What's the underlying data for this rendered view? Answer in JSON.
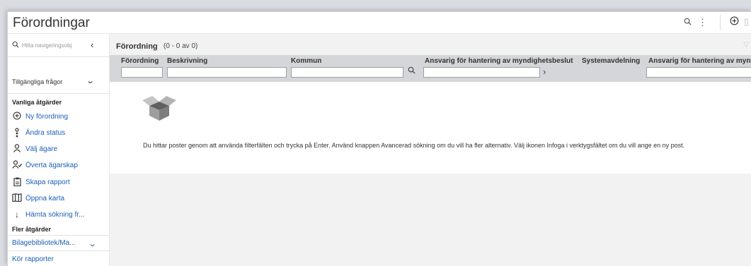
{
  "header": {
    "title": "Förordningar",
    "search_icon": "search-icon",
    "more_icon": "more-vertical-icon",
    "add_icon": "add-circle-icon"
  },
  "sidebar": {
    "search_placeholder": "Hitta navigeringsobj",
    "queries_label": "Tillgängliga frågor",
    "common_actions_label": "Vanliga åtgärder",
    "common_actions": [
      {
        "label": "Ny förordning",
        "icon": "add-circle-icon"
      },
      {
        "label": "Ändra status",
        "icon": "status-icon"
      },
      {
        "label": "Välj ägare",
        "icon": "person-icon"
      },
      {
        "label": "Överta ägarskap",
        "icon": "take-ownership-icon"
      },
      {
        "label": "Skapa rapport",
        "icon": "clipboard-icon"
      },
      {
        "label": "Öppna karta",
        "icon": "map-icon"
      },
      {
        "label": "Hämta sökning fr...",
        "icon": "arrow-down-icon"
      }
    ],
    "more_actions_label": "Fler åtgärder",
    "attachment_library": "Bilagebibliotek/Ma...",
    "run_reports": "Kör rapporter"
  },
  "main": {
    "table_title": "Förordning",
    "count": "(0 - 0 av 0)",
    "columns": [
      "Förordning",
      "Beskrivning",
      "Kommun",
      "Ansvarig för hantering av myndighetsbeslut",
      "Systemavdelning",
      "Ansvarig för hantering av myndi"
    ],
    "empty_message": "Du hittar poster genom att använda filterfälten och trycka på Enter. Använd knappen Avancerad sökning om du vill ha fler alternativ. Välj ikonen Infoga i verktygsfältet om du vill ange en ny post."
  }
}
